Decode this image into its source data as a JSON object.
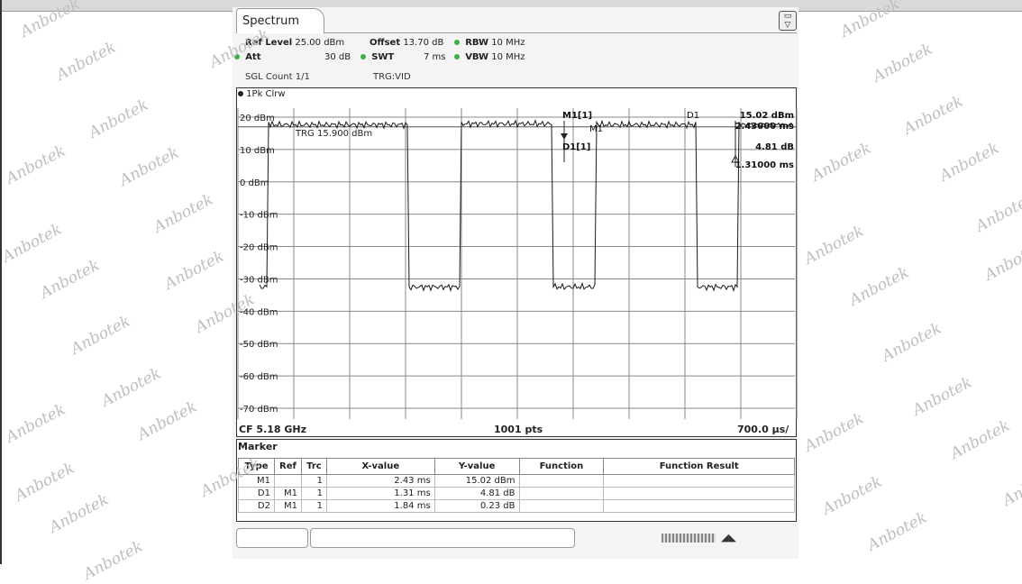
{
  "window": {
    "tab_label": "Spectrum",
    "tab_icon": "display-config-icon"
  },
  "settings": {
    "ref_level_label": "Ref Level",
    "ref_level_value": "25.00 dBm",
    "offset_label": "Offset",
    "offset_value": "13.70 dB",
    "rbw_label": "RBW",
    "rbw_value": "10 MHz",
    "att_label": "Att",
    "att_value": "30 dB",
    "swt_label": "SWT",
    "swt_value": "7 ms",
    "vbw_label": "VBW",
    "vbw_value": "10 MHz",
    "sgl_count": "SGL Count 1/1",
    "trg": "TRG:VID"
  },
  "trace": {
    "label": "1Pk Clrw"
  },
  "plot": {
    "y_labels": [
      "20 dBm",
      "10 dBm",
      "0 dBm",
      "-10 dBm",
      "-20 dBm",
      "-30 dBm",
      "-40 dBm",
      "-50 dBm",
      "-60 dBm",
      "-70 dBm"
    ],
    "trg_line_label": "TRG 15.900 dBm",
    "m1_readout_label": "M1[1]",
    "m1_readout_value": "15.02 dBm",
    "m1_readout_time": "2.43000 ms",
    "d1_readout_label": "D1[1]",
    "d1_readout_value": "4.81 dB",
    "d1_readout_time": "1.31000 ms",
    "m1_tag": "M1",
    "d1_tag": "D1",
    "center_freq": "CF 5.18 GHz",
    "points": "1001 pts",
    "span_per_div": "700.0 µs/",
    "trace_color": "#1a1a1a",
    "trigger_line_color": "#555555"
  },
  "marker_table": {
    "title": "Marker",
    "headers": [
      "Type",
      "Ref",
      "Trc",
      "X-value",
      "Y-value",
      "Function",
      "Function Result"
    ],
    "rows": [
      [
        "M1",
        "",
        "1",
        "2.43 ms",
        "15.02 dBm",
        "",
        ""
      ],
      [
        "D1",
        "M1",
        "1",
        "1.31 ms",
        "4.81 dB",
        "",
        ""
      ],
      [
        "D2",
        "M1",
        "1",
        "1.84 ms",
        "0.23 dB",
        "",
        ""
      ]
    ]
  },
  "watermark_text": "Anbotek"
}
